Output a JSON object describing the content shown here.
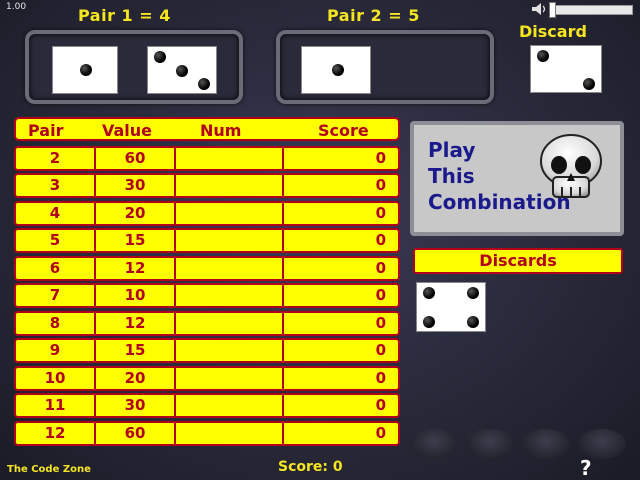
{
  "version": "1.00",
  "pairs": [
    {
      "label": "Pair 1 = 4"
    },
    {
      "label": "Pair 2 = 5"
    }
  ],
  "discard_label": "Discard",
  "table": {
    "headers": [
      "Pair",
      "Value",
      "Num",
      "Score"
    ],
    "rows": [
      {
        "pair": "2",
        "value": "60",
        "num": "",
        "score": "0"
      },
      {
        "pair": "3",
        "value": "30",
        "num": "",
        "score": "0"
      },
      {
        "pair": "4",
        "value": "20",
        "num": "",
        "score": "0"
      },
      {
        "pair": "5",
        "value": "15",
        "num": "",
        "score": "0"
      },
      {
        "pair": "6",
        "value": "12",
        "num": "",
        "score": "0"
      },
      {
        "pair": "7",
        "value": "10",
        "num": "",
        "score": "0"
      },
      {
        "pair": "8",
        "value": "12",
        "num": "",
        "score": "0"
      },
      {
        "pair": "9",
        "value": "15",
        "num": "",
        "score": "0"
      },
      {
        "pair": "10",
        "value": "20",
        "num": "",
        "score": "0"
      },
      {
        "pair": "11",
        "value": "30",
        "num": "",
        "score": "0"
      },
      {
        "pair": "12",
        "value": "60",
        "num": "",
        "score": "0"
      }
    ]
  },
  "play_button": {
    "line1": "Play",
    "line2": "This",
    "line3": "Combination"
  },
  "discards_title": "Discards",
  "footer": {
    "brand": "The Code Zone",
    "score": "Score: 0",
    "help": "?"
  },
  "dice": {
    "pair1_die1": 1,
    "pair1_die2": 3,
    "pair2_die1": 1,
    "discard_die": 2,
    "discards_die": 4
  },
  "colors": {
    "yellow": "#ffff00",
    "red": "#b3001a",
    "title_yellow": "#f5e620",
    "button_blue": "#1a1a8c"
  },
  "icons": [
    "speaker-icon",
    "skull-icon",
    "help-icon"
  ]
}
